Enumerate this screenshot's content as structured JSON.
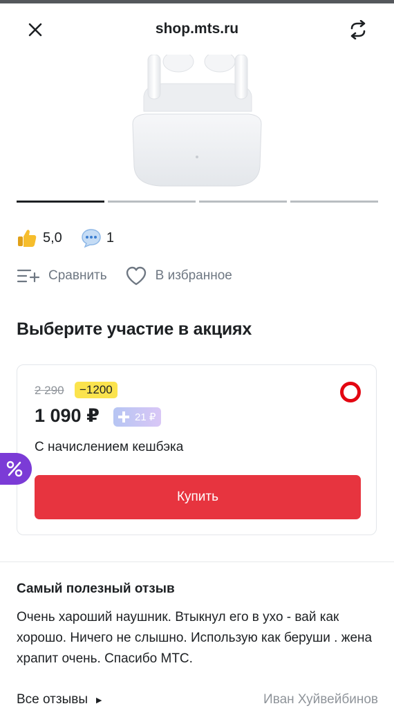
{
  "header": {
    "title": "shop.mts.ru",
    "close_icon": "close-icon",
    "refresh_icon": "refresh-icon"
  },
  "gallery": {
    "slides_total": 4,
    "active_slide_index": 0
  },
  "rating": {
    "score": "5,0",
    "comments_count": "1"
  },
  "actions": {
    "compare_label": "Сравнить",
    "favorite_label": "В избранное"
  },
  "promotions": {
    "title": "Выберите участие в акциях",
    "offer": {
      "old_price": "2 290",
      "discount": "−1200",
      "price": "1 090 ₽",
      "cashback": "21 ₽",
      "note": "С начислением кешбэка",
      "buy_label": "Купить",
      "selected": true
    }
  },
  "review": {
    "title": "Самый полезный отзыв",
    "text": "Очень хароший наушник. Втыкнул его в ухо - вай как хорошо. Ничего не слышно. Использую как беруши . жена храпит очень. Спасибо МТС.",
    "all_reviews_label": "Все отзывы",
    "author": "Иван Хуйвейбинов"
  },
  "colors": {
    "accent_red": "#E30611",
    "buy_button": "#E7343F",
    "discount_yellow": "#FBE34D",
    "promo_purple": "#7B3BD6",
    "text_primary": "#1D2023",
    "text_secondary": "#6E7782"
  }
}
